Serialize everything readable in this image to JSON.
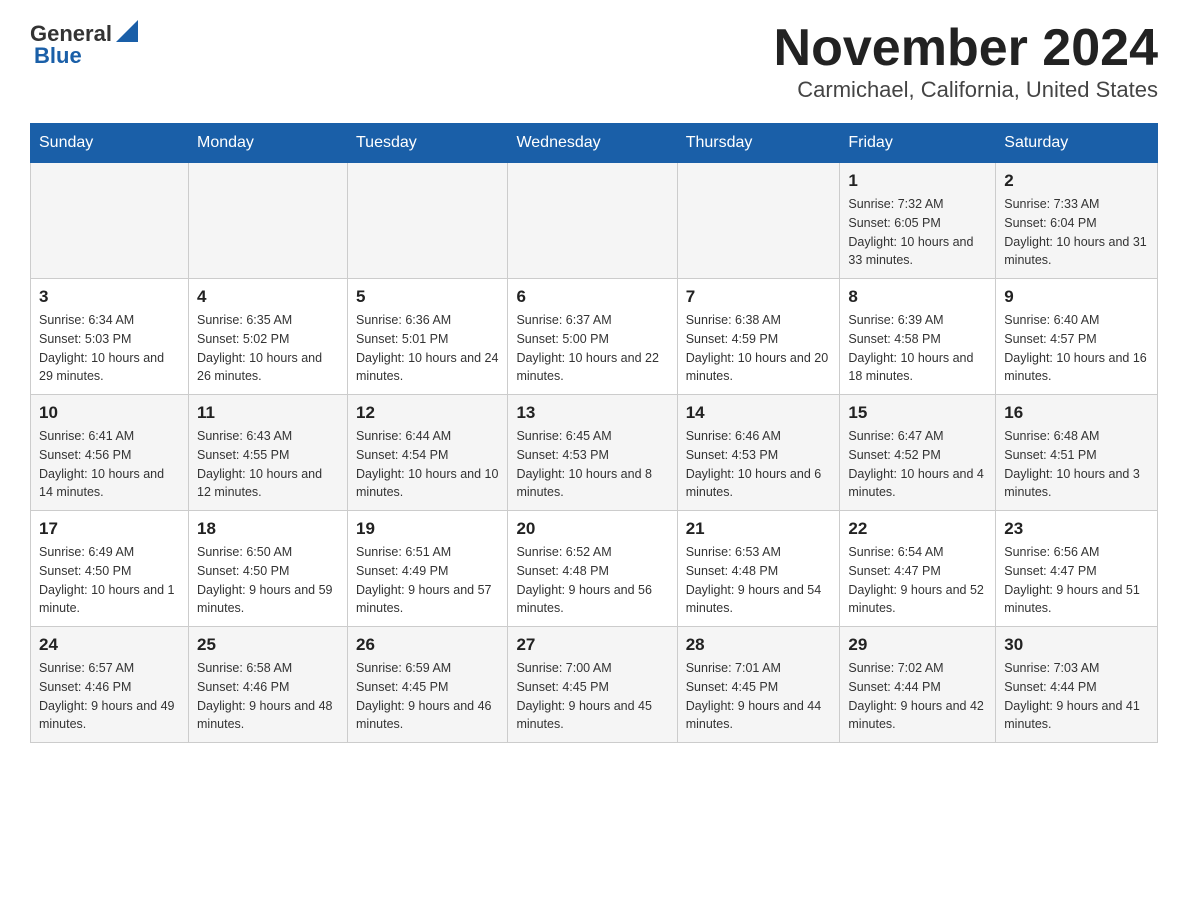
{
  "header": {
    "title": "November 2024",
    "subtitle": "Carmichael, California, United States"
  },
  "logo": {
    "general": "General",
    "blue": "Blue"
  },
  "days_of_week": [
    "Sunday",
    "Monday",
    "Tuesday",
    "Wednesday",
    "Thursday",
    "Friday",
    "Saturday"
  ],
  "weeks": [
    [
      {
        "day": "",
        "info": ""
      },
      {
        "day": "",
        "info": ""
      },
      {
        "day": "",
        "info": ""
      },
      {
        "day": "",
        "info": ""
      },
      {
        "day": "",
        "info": ""
      },
      {
        "day": "1",
        "info": "Sunrise: 7:32 AM\nSunset: 6:05 PM\nDaylight: 10 hours and 33 minutes."
      },
      {
        "day": "2",
        "info": "Sunrise: 7:33 AM\nSunset: 6:04 PM\nDaylight: 10 hours and 31 minutes."
      }
    ],
    [
      {
        "day": "3",
        "info": "Sunrise: 6:34 AM\nSunset: 5:03 PM\nDaylight: 10 hours and 29 minutes."
      },
      {
        "day": "4",
        "info": "Sunrise: 6:35 AM\nSunset: 5:02 PM\nDaylight: 10 hours and 26 minutes."
      },
      {
        "day": "5",
        "info": "Sunrise: 6:36 AM\nSunset: 5:01 PM\nDaylight: 10 hours and 24 minutes."
      },
      {
        "day": "6",
        "info": "Sunrise: 6:37 AM\nSunset: 5:00 PM\nDaylight: 10 hours and 22 minutes."
      },
      {
        "day": "7",
        "info": "Sunrise: 6:38 AM\nSunset: 4:59 PM\nDaylight: 10 hours and 20 minutes."
      },
      {
        "day": "8",
        "info": "Sunrise: 6:39 AM\nSunset: 4:58 PM\nDaylight: 10 hours and 18 minutes."
      },
      {
        "day": "9",
        "info": "Sunrise: 6:40 AM\nSunset: 4:57 PM\nDaylight: 10 hours and 16 minutes."
      }
    ],
    [
      {
        "day": "10",
        "info": "Sunrise: 6:41 AM\nSunset: 4:56 PM\nDaylight: 10 hours and 14 minutes."
      },
      {
        "day": "11",
        "info": "Sunrise: 6:43 AM\nSunset: 4:55 PM\nDaylight: 10 hours and 12 minutes."
      },
      {
        "day": "12",
        "info": "Sunrise: 6:44 AM\nSunset: 4:54 PM\nDaylight: 10 hours and 10 minutes."
      },
      {
        "day": "13",
        "info": "Sunrise: 6:45 AM\nSunset: 4:53 PM\nDaylight: 10 hours and 8 minutes."
      },
      {
        "day": "14",
        "info": "Sunrise: 6:46 AM\nSunset: 4:53 PM\nDaylight: 10 hours and 6 minutes."
      },
      {
        "day": "15",
        "info": "Sunrise: 6:47 AM\nSunset: 4:52 PM\nDaylight: 10 hours and 4 minutes."
      },
      {
        "day": "16",
        "info": "Sunrise: 6:48 AM\nSunset: 4:51 PM\nDaylight: 10 hours and 3 minutes."
      }
    ],
    [
      {
        "day": "17",
        "info": "Sunrise: 6:49 AM\nSunset: 4:50 PM\nDaylight: 10 hours and 1 minute."
      },
      {
        "day": "18",
        "info": "Sunrise: 6:50 AM\nSunset: 4:50 PM\nDaylight: 9 hours and 59 minutes."
      },
      {
        "day": "19",
        "info": "Sunrise: 6:51 AM\nSunset: 4:49 PM\nDaylight: 9 hours and 57 minutes."
      },
      {
        "day": "20",
        "info": "Sunrise: 6:52 AM\nSunset: 4:48 PM\nDaylight: 9 hours and 56 minutes."
      },
      {
        "day": "21",
        "info": "Sunrise: 6:53 AM\nSunset: 4:48 PM\nDaylight: 9 hours and 54 minutes."
      },
      {
        "day": "22",
        "info": "Sunrise: 6:54 AM\nSunset: 4:47 PM\nDaylight: 9 hours and 52 minutes."
      },
      {
        "day": "23",
        "info": "Sunrise: 6:56 AM\nSunset: 4:47 PM\nDaylight: 9 hours and 51 minutes."
      }
    ],
    [
      {
        "day": "24",
        "info": "Sunrise: 6:57 AM\nSunset: 4:46 PM\nDaylight: 9 hours and 49 minutes."
      },
      {
        "day": "25",
        "info": "Sunrise: 6:58 AM\nSunset: 4:46 PM\nDaylight: 9 hours and 48 minutes."
      },
      {
        "day": "26",
        "info": "Sunrise: 6:59 AM\nSunset: 4:45 PM\nDaylight: 9 hours and 46 minutes."
      },
      {
        "day": "27",
        "info": "Sunrise: 7:00 AM\nSunset: 4:45 PM\nDaylight: 9 hours and 45 minutes."
      },
      {
        "day": "28",
        "info": "Sunrise: 7:01 AM\nSunset: 4:45 PM\nDaylight: 9 hours and 44 minutes."
      },
      {
        "day": "29",
        "info": "Sunrise: 7:02 AM\nSunset: 4:44 PM\nDaylight: 9 hours and 42 minutes."
      },
      {
        "day": "30",
        "info": "Sunrise: 7:03 AM\nSunset: 4:44 PM\nDaylight: 9 hours and 41 minutes."
      }
    ]
  ]
}
